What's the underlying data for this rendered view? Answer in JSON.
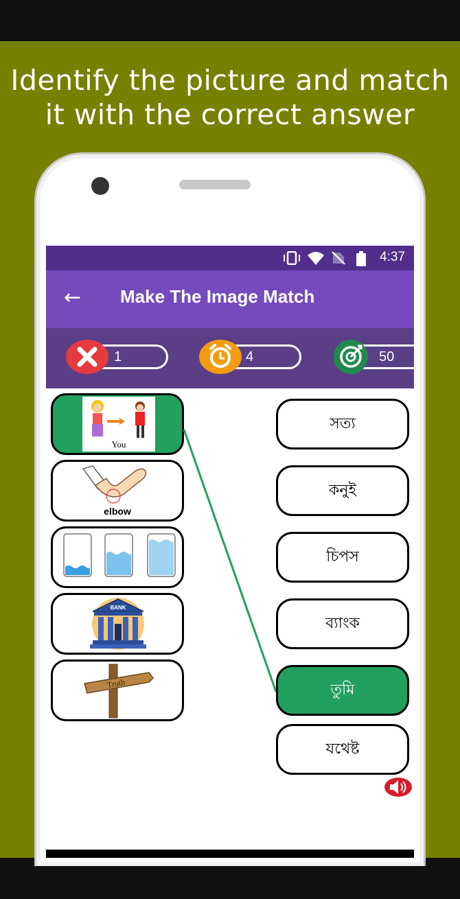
{
  "headline": "Identify the picture and match it with the correct answer",
  "status": {
    "time": "4:37"
  },
  "appbar": {
    "title": "Make The Image Match"
  },
  "score": {
    "wrong": "1",
    "time": "4",
    "target": "50"
  },
  "images": [
    {
      "name": "you-picture",
      "caption": "You"
    },
    {
      "name": "elbow-picture",
      "caption": "elbow"
    },
    {
      "name": "water-levels-picture",
      "caption": ""
    },
    {
      "name": "bank-picture",
      "caption": "BANK"
    },
    {
      "name": "truth-signpost-picture",
      "caption": "Truth"
    }
  ],
  "answers": [
    "সত্য",
    "কনুই",
    "চিপস",
    "ব্যাংক",
    "তুমি",
    "যথেষ্ট"
  ],
  "colors": {
    "background": "#778000",
    "selected": "#22a05e",
    "appbar": "#7649bd",
    "statusbar": "#512d8c"
  }
}
